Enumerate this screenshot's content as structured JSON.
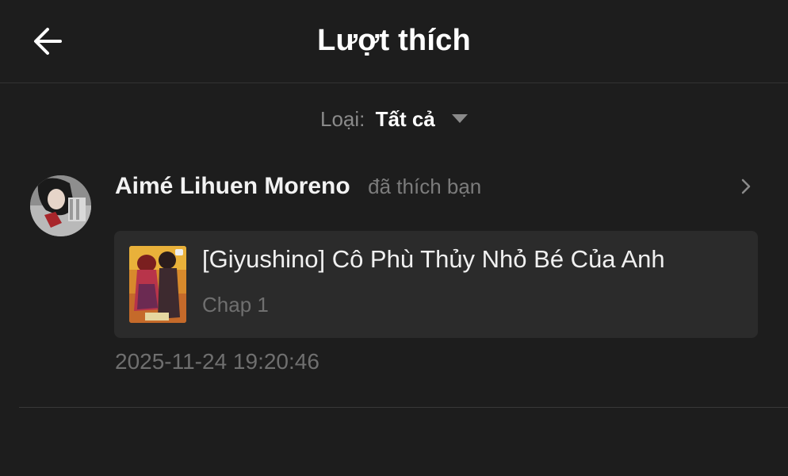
{
  "header": {
    "title": "Lượt thích",
    "back_icon": "arrow-left-icon"
  },
  "filter": {
    "label": "Loại:",
    "value": "Tất cả",
    "icon": "caret-down-icon"
  },
  "likes": [
    {
      "user_name": "Aimé Lihuen Moreno",
      "action": "đã thích bạn",
      "story_title": "[Giyushino] Cô Phù Thủy Nhỏ Bé Của Anh",
      "chapter": "Chap 1",
      "timestamp": "2025-11-24 19:20:46",
      "chevron_icon": "chevron-right-icon"
    }
  ],
  "colors": {
    "background": "#1d1d1d",
    "card": "#2b2b2b",
    "text_primary": "#ffffff",
    "text_secondary": "#7c7c7c"
  }
}
